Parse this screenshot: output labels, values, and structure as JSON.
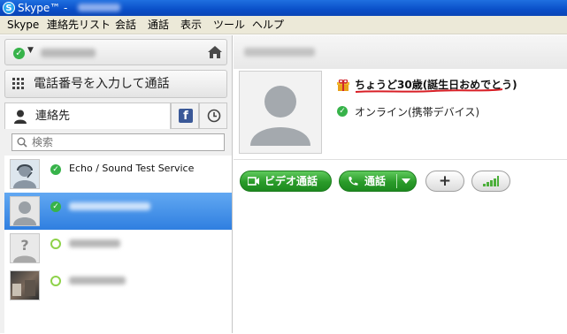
{
  "window": {
    "title": "Skype™ -",
    "logo_letter": "S"
  },
  "menu": [
    "Skype",
    "連絡先リスト",
    "会話",
    "通話",
    "表示",
    "ツール",
    "ヘルプ"
  ],
  "dialpad": {
    "label": "電話番号を入力して通話"
  },
  "contacts_tab": {
    "label": "連絡先",
    "facebook_letter": "f"
  },
  "search": {
    "placeholder": "検索"
  },
  "contacts": [
    {
      "name": "Echo / Sound Test Service",
      "status": "online"
    },
    {
      "name": "",
      "status": "online",
      "selected": true
    },
    {
      "name": "",
      "status": "offline"
    },
    {
      "name": "",
      "status": "offline"
    }
  ],
  "profile": {
    "birthday": "ちょうど30歳(誕生日おめでとう)",
    "status_text": "オンライン(携帯デバイス)"
  },
  "actions": {
    "video_call": "ビデオ通話",
    "call": "通話",
    "add": "+"
  },
  "colors": {
    "accent_green": "#2a9b2a",
    "selection_blue": "#3d8be6",
    "underline_red": "#d81f26"
  }
}
